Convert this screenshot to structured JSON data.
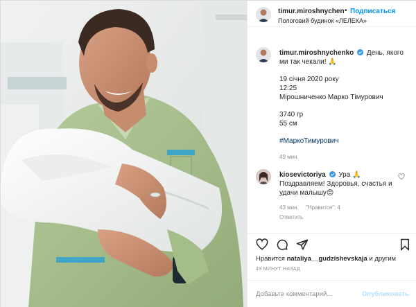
{
  "header": {
    "username": "timur.miroshnychenko",
    "separator": "•",
    "follow_label": "Подписаться",
    "location": "Пологовий будинок «ЛЕЛЕКА»"
  },
  "caption": {
    "username": "timur.miroshnychenko",
    "text": "День, якого ми так чекали! 🙏",
    "date": "19 січня 2020 року",
    "time": "12:25",
    "name": "Мірошниченко Марко Тімурович",
    "weight": "3740 гр",
    "height": "55 см",
    "hashtag": "#МаркоТимурович",
    "posted": "49 мин."
  },
  "comment": {
    "username": "kiosevictoriya",
    "text_line1": "Ура 🙏",
    "text_line2": "Поздравляем! Здоровья, счастья и удачи малышу😍",
    "time": "43 мин.",
    "likes": "\"Нравится\": 4",
    "reply": "Ответить"
  },
  "actions": {
    "likes_prefix": "Нравится ",
    "likes_user": "nataliya__gudzishevskaja",
    "likes_suffix": " и другим",
    "time_ago": "49 МИНУТ НАЗАД"
  },
  "add_comment": {
    "placeholder": "Добавьте комментарий...",
    "publish_label": "Опубликовать"
  },
  "colors": {
    "link_blue": "#0095f6",
    "publish_disabled": "#b2dffc",
    "muted": "#8e8e8e",
    "text": "#262626",
    "scrub_green": "#a9c08d"
  }
}
